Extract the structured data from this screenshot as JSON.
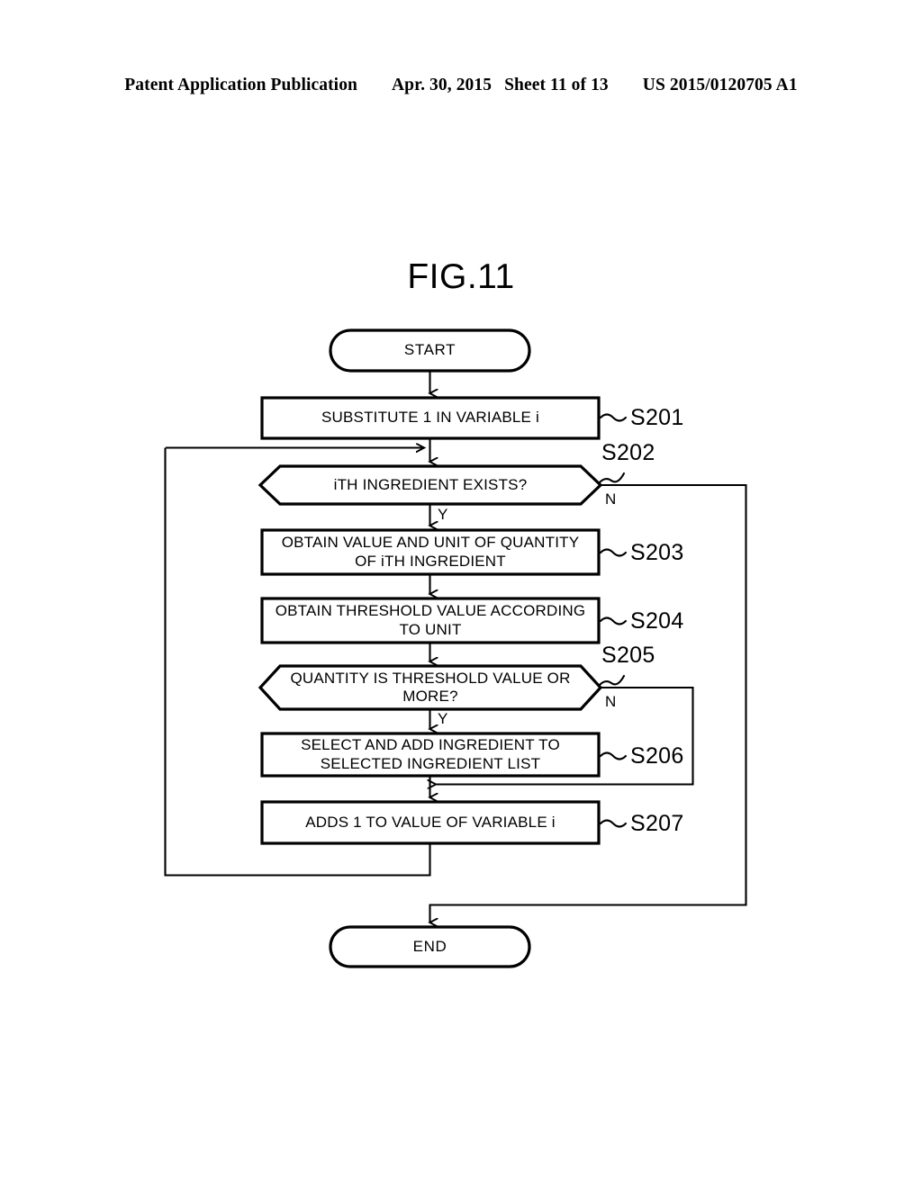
{
  "header": {
    "left": "Patent Application Publication",
    "date": "Apr. 30, 2015",
    "sheet": "Sheet 11 of 13",
    "pub_number": "US 2015/0120705 A1"
  },
  "figure": {
    "title": "FIG.11",
    "type": "flowchart"
  },
  "chart_data": {
    "type": "diagram",
    "title": "FIG.11",
    "nodes": [
      {
        "id": "start",
        "shape": "terminal",
        "label": "START",
        "step": ""
      },
      {
        "id": "s201",
        "shape": "process",
        "label": "SUBSTITUTE 1 IN VARIABLE i",
        "step": "S201"
      },
      {
        "id": "s202",
        "shape": "decision",
        "label": "iTH INGREDIENT EXISTS?",
        "step": "S202"
      },
      {
        "id": "s203",
        "shape": "process",
        "label": "OBTAIN VALUE AND UNIT OF QUANTITY\nOF iTH INGREDIENT",
        "step": "S203"
      },
      {
        "id": "s204",
        "shape": "process",
        "label": "OBTAIN THRESHOLD VALUE ACCORDING\nTO UNIT",
        "step": "S204"
      },
      {
        "id": "s205",
        "shape": "decision",
        "label": "QUANTITY IS THRESHOLD VALUE OR\nMORE?",
        "step": "S205"
      },
      {
        "id": "s206",
        "shape": "process",
        "label": "SELECT AND ADD INGREDIENT TO\nSELECTED INGREDIENT LIST",
        "step": "S206"
      },
      {
        "id": "s207",
        "shape": "process",
        "label": "ADDS 1 TO VALUE OF VARIABLE i",
        "step": "S207"
      },
      {
        "id": "end",
        "shape": "terminal",
        "label": "END",
        "step": ""
      }
    ],
    "edges": [
      {
        "from": "start",
        "to": "s201",
        "label": ""
      },
      {
        "from": "s201",
        "to": "s202",
        "label": ""
      },
      {
        "from": "s202",
        "to": "s203",
        "label": "Y"
      },
      {
        "from": "s202",
        "to": "end",
        "label": "N"
      },
      {
        "from": "s203",
        "to": "s204",
        "label": ""
      },
      {
        "from": "s204",
        "to": "s205",
        "label": ""
      },
      {
        "from": "s205",
        "to": "s206",
        "label": "Y"
      },
      {
        "from": "s205",
        "to": "s207",
        "label": "N"
      },
      {
        "from": "s206",
        "to": "s207",
        "label": ""
      },
      {
        "from": "s207",
        "to": "s202",
        "label": ""
      }
    ],
    "branch_labels": {
      "s202_no": "N",
      "s202_yes": "Y",
      "s205_no": "N",
      "s205_yes": "Y"
    },
    "colors": {
      "stroke": "#000000",
      "fill": "#ffffff",
      "background": "#ffffff"
    }
  }
}
